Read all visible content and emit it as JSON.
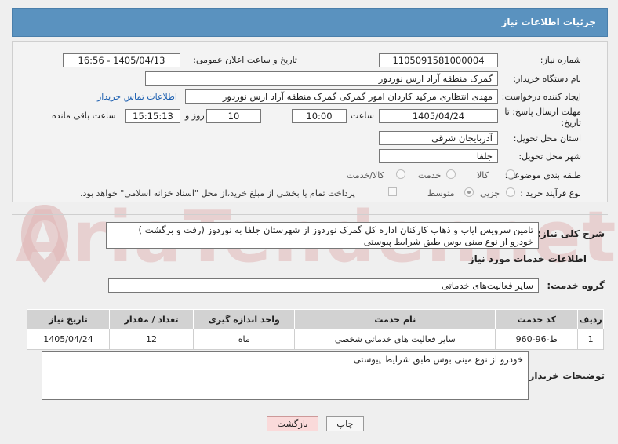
{
  "header": {
    "title": "جزئیات اطلاعات نیاز"
  },
  "form": {
    "need_number_label": "شماره نیاز:",
    "need_number": "1105091581000004",
    "announce_label": "تاریخ و ساعت اعلان عمومی:",
    "announce_value": "1405/04/13 - 16:56",
    "buyer_org_label": "نام دستگاه خریدار:",
    "buyer_org": "گمرک منطقه آزاد ارس نوردوز",
    "creator_label": "ایجاد کننده درخواست:",
    "creator": "مهدی انتظاری مرکید کاردان امور گمرکی گمرک منطقه آزاد ارس نوردوز",
    "contact_link": "اطلاعات تماس خریدار",
    "deadline_label_1": "مهلت ارسال پاسخ: تا",
    "deadline_label_2": "تاریخ:",
    "deadline_date": "1405/04/24",
    "time_label": "ساعت",
    "deadline_time": "10:00",
    "days_value": "10",
    "days_label": "روز و",
    "remaining_time": "15:15:13",
    "remaining_label": "ساعت باقی مانده",
    "province_label": "استان محل تحویل:",
    "province": "آذربایجان شرقی",
    "city_label": "شهر محل تحویل:",
    "city": "جلفا",
    "category_label": "طبقه بندی موضوعی:",
    "category_options": [
      "کالا",
      "خدمت",
      "کالا/خدمت"
    ],
    "process_label": "نوع فرآیند خرید :",
    "process_options": [
      "جزیی",
      "متوسط"
    ],
    "payment_note": "پرداخت تمام یا بخشی از مبلغ خرید،از محل \"اسناد خزانه اسلامی\" خواهد بود."
  },
  "summary": {
    "label": "شرح کلی نیاز:",
    "text_line1": "تامین سرویس ایاب و ذهاب کارکنان اداره کل گمرک نوردوز از شهرستان جلفا به نوردوز (رفت و برگشت )",
    "text_line2": "خودرو از نوع مینی بوس طبق شرایط پیوستی"
  },
  "services": {
    "title": "اطلاعات خدمات مورد نیاز",
    "group_label": "گروه خدمت:",
    "group_value": "سایر فعالیت‌های خدماتی",
    "columns": [
      "ردیف",
      "کد خدمت",
      "نام خدمت",
      "واحد اندازه گیری",
      "تعداد / مقدار",
      "تاریخ نیاز"
    ],
    "rows": [
      [
        "1",
        "ط-96-960",
        "سایر فعالیت های خدماتی شخصی",
        "ماه",
        "12",
        "1405/04/24"
      ]
    ]
  },
  "buyer_notes": {
    "label": "توضیحات خریدار:",
    "text": "خودرو از نوع مینی بوس طبق شرایط پیوستی"
  },
  "buttons": {
    "print": "چاپ",
    "back": "بازگشت"
  },
  "watermark": {
    "text": "AriaTender.net"
  },
  "icons": {
    "logo": "aria-tender-logo-icon"
  }
}
